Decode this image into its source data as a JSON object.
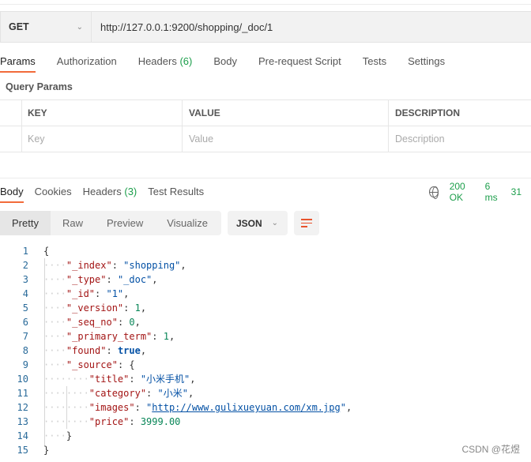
{
  "request": {
    "method": "GET",
    "url": "http://127.0.0.1:9200/shopping/_doc/1"
  },
  "request_tabs": [
    {
      "label": "Params",
      "active": true
    },
    {
      "label": "Authorization"
    },
    {
      "label": "Headers",
      "count": "(6)"
    },
    {
      "label": "Body"
    },
    {
      "label": "Pre-request Script"
    },
    {
      "label": "Tests"
    },
    {
      "label": "Settings"
    }
  ],
  "query_params": {
    "title": "Query Params",
    "headers": [
      "KEY",
      "VALUE",
      "DESCRIPTION"
    ],
    "placeholders": [
      "Key",
      "Value",
      "Description"
    ]
  },
  "response_tabs": [
    {
      "label": "Body",
      "active": true
    },
    {
      "label": "Cookies"
    },
    {
      "label": "Headers",
      "count": "(3)"
    },
    {
      "label": "Test Results"
    }
  ],
  "status": {
    "code": "200 OK",
    "time": "6 ms",
    "size": "31"
  },
  "view_modes": [
    {
      "label": "Pretty",
      "active": true
    },
    {
      "label": "Raw"
    },
    {
      "label": "Preview"
    },
    {
      "label": "Visualize"
    }
  ],
  "format": "JSON",
  "colors": {
    "accent": "#f26b3a",
    "status": "#1c9e4b",
    "key": "#a31515",
    "string": "#0451a5",
    "number": "#098658"
  },
  "code_lines": [
    [
      [
        "p",
        "{"
      ]
    ],
    [
      [
        "d",
        "····"
      ],
      [
        "k",
        "\"_index\""
      ],
      [
        "p",
        ": "
      ],
      [
        "s",
        "\"shopping\""
      ],
      [
        "p",
        ","
      ]
    ],
    [
      [
        "d",
        "····"
      ],
      [
        "k",
        "\"_type\""
      ],
      [
        "p",
        ": "
      ],
      [
        "s",
        "\"_doc\""
      ],
      [
        "p",
        ","
      ]
    ],
    [
      [
        "d",
        "····"
      ],
      [
        "k",
        "\"_id\""
      ],
      [
        "p",
        ": "
      ],
      [
        "s",
        "\"1\""
      ],
      [
        "p",
        ","
      ]
    ],
    [
      [
        "d",
        "····"
      ],
      [
        "k",
        "\"_version\""
      ],
      [
        "p",
        ": "
      ],
      [
        "n",
        "1"
      ],
      [
        "p",
        ","
      ]
    ],
    [
      [
        "d",
        "····"
      ],
      [
        "k",
        "\"_seq_no\""
      ],
      [
        "p",
        ": "
      ],
      [
        "n",
        "0"
      ],
      [
        "p",
        ","
      ]
    ],
    [
      [
        "d",
        "····"
      ],
      [
        "k",
        "\"_primary_term\""
      ],
      [
        "p",
        ": "
      ],
      [
        "n",
        "1"
      ],
      [
        "p",
        ","
      ]
    ],
    [
      [
        "d",
        "····"
      ],
      [
        "k",
        "\"found\""
      ],
      [
        "p",
        ": "
      ],
      [
        "b",
        "true"
      ],
      [
        "p",
        ","
      ]
    ],
    [
      [
        "d",
        "····"
      ],
      [
        "k",
        "\"_source\""
      ],
      [
        "p",
        ": {"
      ]
    ],
    [
      [
        "d",
        "········"
      ],
      [
        "k",
        "\"title\""
      ],
      [
        "p",
        ": "
      ],
      [
        "s",
        "\"小米手机\""
      ],
      [
        "p",
        ","
      ]
    ],
    [
      [
        "d",
        "········"
      ],
      [
        "k",
        "\"category\""
      ],
      [
        "p",
        ": "
      ],
      [
        "s",
        "\"小米\""
      ],
      [
        "p",
        ","
      ]
    ],
    [
      [
        "d",
        "········"
      ],
      [
        "k",
        "\"images\""
      ],
      [
        "p",
        ": "
      ],
      [
        "s",
        "\""
      ],
      [
        "u",
        "http://www.gulixueyuan.com/xm.jpg"
      ],
      [
        "s",
        "\""
      ],
      [
        "p",
        ","
      ]
    ],
    [
      [
        "d",
        "········"
      ],
      [
        "k",
        "\"price\""
      ],
      [
        "p",
        ": "
      ],
      [
        "n",
        "3999.00"
      ]
    ],
    [
      [
        "d",
        "····"
      ],
      [
        "p",
        "}"
      ]
    ],
    [
      [
        "p",
        "}"
      ]
    ]
  ],
  "watermark": "CSDN @花煜"
}
